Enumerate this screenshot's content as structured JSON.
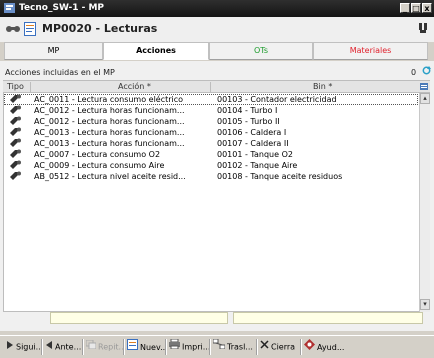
{
  "window": {
    "title": "Tecno_SW-1 - MP",
    "min": "_",
    "max": "□",
    "close": "x"
  },
  "header": {
    "title": "MP0020 - Lecturas"
  },
  "tabs": [
    {
      "label": "MP",
      "color": "#000000"
    },
    {
      "label": "Acciones",
      "color": "#000000"
    },
    {
      "label": "OTs",
      "color": "#1c9c2c"
    },
    {
      "label": "Materiales",
      "color": "#e0202c"
    }
  ],
  "section": {
    "title": "Acciones incluidas en el MP",
    "count": "0"
  },
  "table": {
    "columns": [
      "Tipo",
      "Acción *",
      "Bin *"
    ],
    "rows": [
      {
        "accion": "AC_0011 - Lectura consumo eléctrico",
        "bin": "00103 - Contador electricidad"
      },
      {
        "accion": "AC_0012 - Lectura horas funcionam...",
        "bin": "00104 - Turbo I"
      },
      {
        "accion": "AC_0012 - Lectura horas funcionam...",
        "bin": "00105 - Turbo II"
      },
      {
        "accion": "AC_0013 - Lectura horas funcionam...",
        "bin": "00106 - Caldera I"
      },
      {
        "accion": "AC_0013 - Lectura horas funcionam...",
        "bin": "00107 - Caldera II"
      },
      {
        "accion": "AC_0007 - Lectura consumo O2",
        "bin": "00101 - Tanque O2"
      },
      {
        "accion": "AC_0009 - Lectura consumo Aire",
        "bin": "00102 - Tanque Aire"
      },
      {
        "accion": "AB_0512 - Lectura nivel aceite resid...",
        "bin": "00108 - Tanque aceite residuos"
      }
    ]
  },
  "toolbar": {
    "siguiente": "Sigui...",
    "anterior": "Ante...",
    "repetir": "Repit...",
    "nuevo": "Nuev...",
    "imprimir": "Impri...",
    "trasladar": "Trasl...",
    "cerrar": "Cierra",
    "ayuda": "Ayud..."
  }
}
